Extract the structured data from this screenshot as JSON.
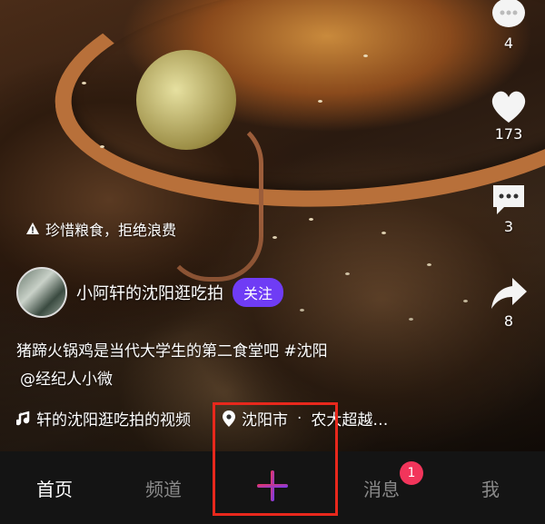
{
  "counts": {
    "top_item": "4",
    "likes": "173",
    "comments": "3",
    "shares": "8"
  },
  "warning": {
    "text": "珍惜粮食，拒绝浪费"
  },
  "author": {
    "name": "小阿轩的沈阳逛吃拍",
    "follow_label": "关注"
  },
  "caption": {
    "text": "猪蹄火锅鸡是当代大学生的第二食堂吧",
    "hashtag": "#沈阳",
    "mention": "@经纪人小微"
  },
  "music": {
    "text": "轩的沈阳逛吃拍的视频"
  },
  "location": {
    "city": "沈阳市",
    "separator": "·",
    "place": "农大超越…"
  },
  "nav": {
    "home": "首页",
    "channel": "频道",
    "messages": "消息",
    "messages_badge": "1",
    "me": "我"
  },
  "colors": {
    "follow_bg": "#6f3cf5",
    "badge_bg": "#f2355b",
    "highlight": "#e8281c",
    "plus_gradient_start": "#f2355b",
    "plus_gradient_end": "#6f3cf5"
  },
  "icons": {
    "top_item": "bubble-icon",
    "likes": "heart-icon",
    "comments": "comment-icon",
    "shares": "share-icon",
    "warning": "warning-icon",
    "music": "music-note-icon",
    "location": "location-pin-icon",
    "create": "plus-icon"
  }
}
